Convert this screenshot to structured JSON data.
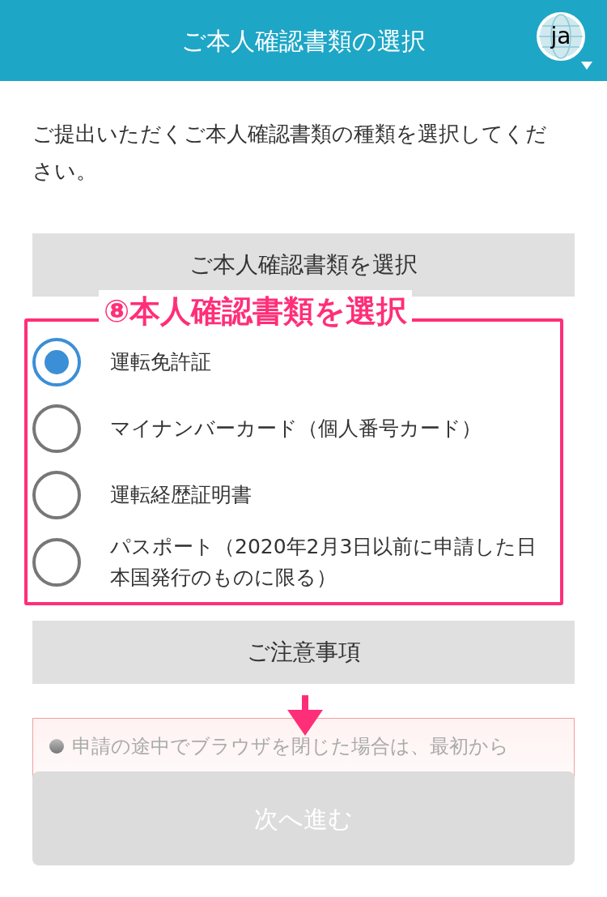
{
  "header": {
    "title": "ご本人確認書類の選択",
    "language": "ja"
  },
  "intro": "ご提出いただくご本人確認書類の種類を選択してください。",
  "document_section": {
    "title": "ご本人確認書類を選択",
    "options": [
      {
        "label": "運転免許証",
        "selected": true
      },
      {
        "label": "マイナンバーカード（個人番号カード）",
        "selected": false
      },
      {
        "label": "運転経歴証明書",
        "selected": false
      },
      {
        "label": "パスポート（2020年2月3日以前に申請した日本国発行のものに限る）",
        "selected": false
      }
    ]
  },
  "annotation": {
    "label": "⑧本人確認書類を選択"
  },
  "notice_section": {
    "title": "ご注意事項",
    "items": [
      "申請の途中でブラウザを閉じた場合は、最初から"
    ]
  },
  "next_button": {
    "label": "次へ進む",
    "disabled": true
  }
}
